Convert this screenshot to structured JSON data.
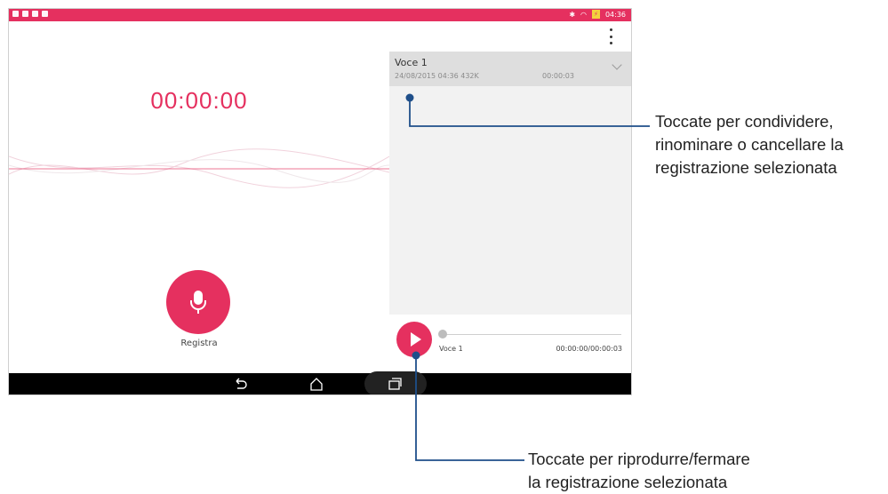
{
  "status_bar": {
    "time": "04:36"
  },
  "recorder": {
    "timer": "00:00:00",
    "record_label": "Registra"
  },
  "recordings": [
    {
      "title": "Voce 1",
      "meta": "24/08/2015 04:36  432K",
      "duration": "00:00:03"
    }
  ],
  "player": {
    "name": "Voce 1",
    "time": "00:00:00/00:00:03",
    "progress": 0
  },
  "callouts": {
    "item_line1": "Toccate per condividere,",
    "item_line2": "rinominare o cancellare la",
    "item_line3": "registrazione selezionata",
    "play_line1": "Toccate per riprodurre/fermare",
    "play_line2": "la registrazione selezionata"
  },
  "colors": {
    "accent": "#e5305f",
    "status_bar": "#e5305f",
    "navbar": "#000000",
    "callout_line": "#1f4f8a"
  },
  "icons": [
    "mic-icon",
    "play-icon",
    "back-icon",
    "home-icon",
    "recents-icon",
    "overflow-menu-icon",
    "chevron-down-icon",
    "wifi-icon",
    "bluetooth-icon",
    "battery-icon"
  ]
}
